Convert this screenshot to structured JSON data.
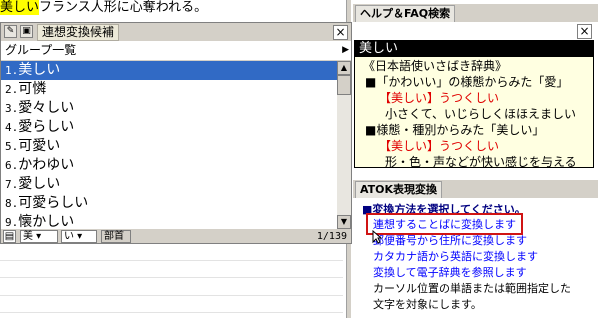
{
  "editor": {
    "highlight": "美しい",
    "rest": "フランス人形に心奪われる。"
  },
  "candidate_window": {
    "title": "連想変換候補",
    "group": "グループ一覧",
    "items": [
      {
        "num": "1.",
        "text": "美しい"
      },
      {
        "num": "2.",
        "text": "可憐"
      },
      {
        "num": "3.",
        "text": "愛々しい"
      },
      {
        "num": "4.",
        "text": "愛らしい"
      },
      {
        "num": "5.",
        "text": "可愛い"
      },
      {
        "num": "6.",
        "text": "かわゆい"
      },
      {
        "num": "7.",
        "text": "愛しい"
      },
      {
        "num": "8.",
        "text": "可愛らしい"
      },
      {
        "num": "9.",
        "text": "懐かしい"
      }
    ],
    "footer": {
      "box1": "美",
      "box2": "い",
      "box3": "部首",
      "count": "1/139"
    }
  },
  "help_panel": {
    "title": "ヘルプ＆FAQ検索",
    "dict": {
      "heading": "美しい",
      "source": "《日本語使いさばき辞典》",
      "section1": "■「かわいい」の様態からみた「愛」",
      "entry1_term": "【美しい】",
      "entry1_reading": "うつくしい",
      "entry1_def": "小さくて、いじらしくほほえましい",
      "section2": "■様態・種別からみた「美しい」",
      "entry2_term": "【美しい】",
      "entry2_reading": "うつくしい",
      "entry2_def": "形・色・声などが快い感じを与える"
    }
  },
  "atok_panel": {
    "title": "ATOK表現変換",
    "prompt": "■変換方法を選択してください。",
    "links": [
      "連想することばに変換します",
      "郵便番号から住所に変換します",
      "カタカナ語から英語に変換します",
      "変換して電子辞典を参照します"
    ],
    "note1": "カーソル位置の単語または範囲指定した",
    "note2": "文字を対象にします。"
  },
  "colors": {
    "selection": "#316ac5",
    "highlight": "#ffff00",
    "dict_bg": "#ffffe1",
    "link": "#0000ff",
    "red_accent": "#e00000",
    "focus_box": "#d01414"
  }
}
